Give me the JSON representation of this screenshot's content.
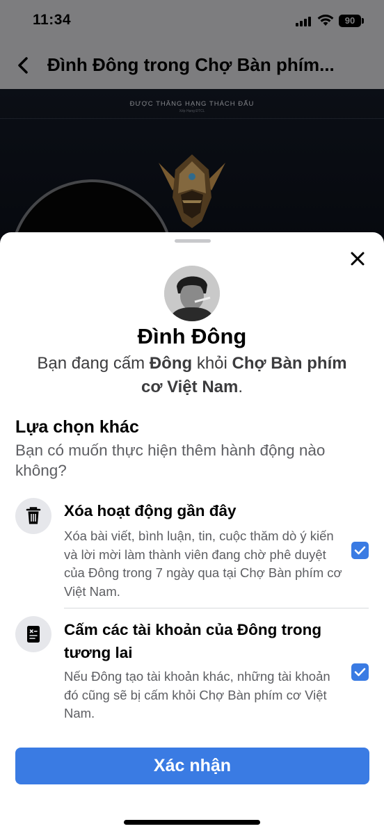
{
  "status_bar": {
    "time": "11:34",
    "battery": "90"
  },
  "header": {
    "title": "Đình Đông trong Chợ Bàn phím..."
  },
  "cover": {
    "title": "ĐƯỢC THĂNG HẠNG THÁCH ĐẤU",
    "subtitle": "Xếp Hạng ĐTCL"
  },
  "sheet": {
    "user_name": "Đình Đông",
    "ban_message": {
      "part1": "Bạn đang cấm ",
      "name": "Đông",
      "part2": " khỏi ",
      "group": "Chợ Bàn phím cơ Việt Nam",
      "part3": "."
    },
    "section_title": "Lựa chọn khác",
    "section_desc": "Bạn có muốn thực hiện thêm hành động nào không?",
    "options": [
      {
        "title": "Xóa hoạt động gần đây",
        "description": "Xóa bài viết, bình luận, tin, cuộc thăm dò ý kiến và lời mời làm thành viên đang chờ phê duyệt của Đông trong 7 ngày qua tại Chợ Bàn phím cơ Việt Nam.",
        "icon": "trash-icon",
        "checked": true
      },
      {
        "title": "Cấm các tài khoản của Đông trong tương lai",
        "description": "Nếu Đông tạo tài khoản khác, những tài khoản đó cũng sẽ bị cấm khỏi Chợ Bàn phím cơ Việt Nam.",
        "icon": "banned-document-icon",
        "checked": true
      }
    ],
    "confirm_label": "Xác nhận"
  },
  "colors": {
    "accent": "#3a7be3",
    "header_bg": "#7d7d7f",
    "sheet_bg": "#ffffff"
  }
}
